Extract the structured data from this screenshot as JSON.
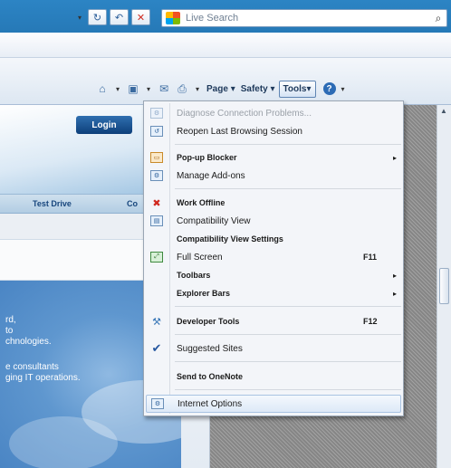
{
  "browser": {
    "search_placeholder": "Live Search",
    "nav_buttons": [
      "▾",
      "↻",
      "↶",
      "✕"
    ]
  },
  "command_bar": {
    "page_label": "Page",
    "safety_label": "Safety",
    "tools_label": "Tools",
    "arrow": "▾"
  },
  "site": {
    "login_label": "Login",
    "nav_test_drive": "Test Drive",
    "nav_co": "Co",
    "hero_lines": [
      "rd,",
      "to",
      "chnologies.",
      "e consultants",
      "ging IT operations."
    ]
  },
  "tools_menu": {
    "items": [
      {
        "label": "Diagnose Connection Problems...",
        "state": "disabled",
        "icon": "diagnose-icon"
      },
      {
        "label": "Reopen Last Browsing Session",
        "icon": "reopen-session-icon"
      },
      {
        "label": "Pop-up Blocker",
        "submenu": true,
        "icon": "popup-blocker-icon"
      },
      {
        "label": "Manage Add-ons",
        "icon": "addons-icon"
      },
      {
        "label": "Work Offline",
        "icon": "work-offline-icon"
      },
      {
        "label": "Compatibility View",
        "icon": "compatibility-view-icon"
      },
      {
        "label": "Compatibility View Settings"
      },
      {
        "label": "Full Screen",
        "shortcut": "F11",
        "icon": "full-screen-icon"
      },
      {
        "label": "Toolbars",
        "submenu": true
      },
      {
        "label": "Explorer Bars",
        "submenu": true
      },
      {
        "label": "Developer Tools",
        "shortcut": "F12",
        "icon": "developer-tools-icon"
      },
      {
        "label": "Suggested Sites",
        "checked": true,
        "icon": "checkmark-icon"
      },
      {
        "label": "Send to OneNote"
      },
      {
        "label": "Internet Options",
        "hovered": true,
        "icon": "internet-options-icon"
      }
    ],
    "submenu_arrow": "▸",
    "check_mark": "✔"
  },
  "colors": {
    "chrome_blue": "#2679b7",
    "menu_bg": "#f3f5f9",
    "hover_border": "#a9c3e2",
    "login_blue": "#0d3f7a"
  }
}
